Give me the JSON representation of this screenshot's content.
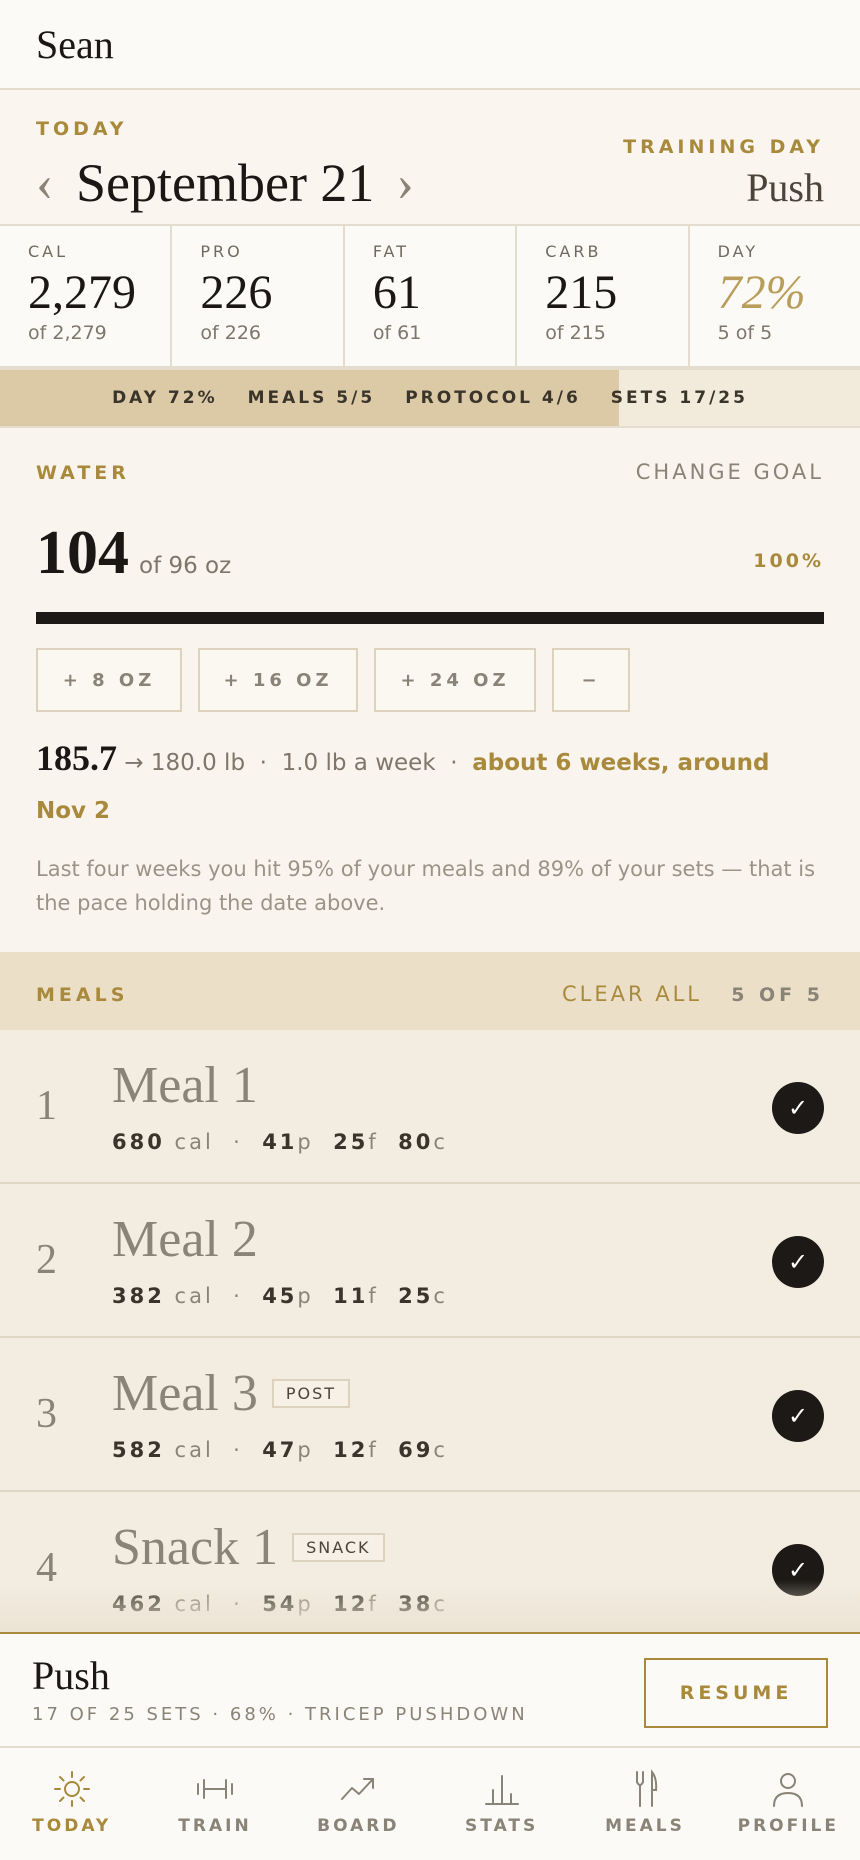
{
  "header": {
    "name": "Sean"
  },
  "date_nav": {
    "today_label": "TODAY",
    "date": "September 21",
    "prev": "‹",
    "next": "›"
  },
  "training_day": {
    "label": "TRAINING DAY",
    "value": "Push"
  },
  "macros": [
    {
      "label": "CAL",
      "value": "2,279",
      "sub": "of 2,279"
    },
    {
      "label": "PRO",
      "value": "226",
      "sub": "of 226"
    },
    {
      "label": "FAT",
      "value": "61",
      "sub": "of 61"
    },
    {
      "label": "CARB",
      "value": "215",
      "sub": "of 215"
    },
    {
      "label": "DAY",
      "value": "72%",
      "sub": "5 of 5"
    }
  ],
  "progress": {
    "fill_fraction": 0.72,
    "day": "DAY 72%",
    "meals": "MEALS 5/5",
    "protocol": "PROTOCOL 4/6",
    "sets": "SETS 17/25"
  },
  "water": {
    "label": "WATER",
    "change_goal": "CHANGE GOAL",
    "amount": "104",
    "of": "of 96 oz",
    "percent": "100%",
    "fill_fraction": 1.0,
    "buttons": [
      "+ 8 OZ",
      "+ 16 OZ",
      "+ 24 OZ",
      "−"
    ]
  },
  "weight": {
    "current": "185.7",
    "target": "→ 180.0 lb",
    "sep": "·",
    "rate": "1.0 lb a week",
    "eta": "about 6 weeks, around Nov 2"
  },
  "note": "Last four weeks you hit 95% of your meals and 89% of your sets — that is the pace holding the date above.",
  "meals_header": {
    "label": "MEALS",
    "clear_all": "CLEAR ALL",
    "count": "5 OF 5"
  },
  "meals": [
    {
      "num": "1",
      "name": "Meal 1",
      "tag": "",
      "cal": "680",
      "p": "41",
      "f": "25",
      "c": "80"
    },
    {
      "num": "2",
      "name": "Meal 2",
      "tag": "",
      "cal": "382",
      "p": "45",
      "f": "11",
      "c": "25"
    },
    {
      "num": "3",
      "name": "Meal 3",
      "tag": "POST",
      "cal": "582",
      "p": "47",
      "f": "12",
      "c": "69"
    },
    {
      "num": "4",
      "name": "Snack 1",
      "tag": "SNACK",
      "cal": "462",
      "p": "54",
      "f": "12",
      "c": "38"
    }
  ],
  "units": {
    "cal": "cal",
    "dot": "·",
    "p": "p",
    "f": "f",
    "c": "c",
    "check": "✓"
  },
  "resume": {
    "title": "Push",
    "sub": "17 OF 25 SETS · 68% · TRICEP PUSHDOWN",
    "button": "RESUME"
  },
  "tabs": [
    {
      "label": "TODAY",
      "icon": "sun-icon",
      "active": true
    },
    {
      "label": "TRAIN",
      "icon": "dumbbell-icon",
      "active": false
    },
    {
      "label": "BOARD",
      "icon": "trend-up-icon",
      "active": false
    },
    {
      "label": "STATS",
      "icon": "bar-chart-icon",
      "active": false
    },
    {
      "label": "MEALS",
      "icon": "utensils-icon",
      "active": false
    },
    {
      "label": "PROFILE",
      "icon": "person-icon",
      "active": false
    }
  ]
}
